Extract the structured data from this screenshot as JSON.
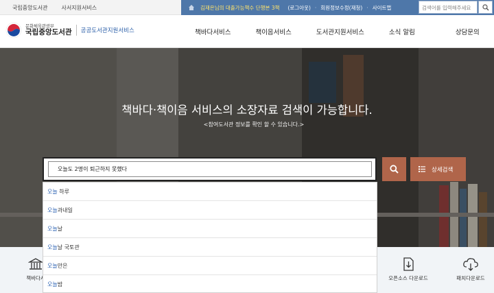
{
  "util_bar": {
    "links_left": [
      "국립중앙도서관",
      "사서지원서비스"
    ],
    "user_text": "김재은님의 대출가능책수 단행본 3책",
    "links_right": [
      "(로그아웃)",
      "회원정보수정(재청)",
      "사이트맵"
    ],
    "search_placeholder": "검색어를 입력해주세요",
    "bar_color": "#4e77a9"
  },
  "logo": {
    "ministry": "문화체육관광부",
    "name": "국립중앙도서관",
    "service": "공공도서관지원서비스"
  },
  "nav": [
    "책바다서비스",
    "책이음서비스",
    "도서관지원서비스",
    "소식 알림",
    "상담문의"
  ],
  "hero": {
    "title": "책바다·책이음 서비스의 소장자료 검색이 가능합니다.",
    "subtitle": "<참여도서관 정보를 확인 할 수 있습니다.>",
    "search_value": "오늘도 2명이 퇴근하지 못했다",
    "advanced_label": "상세검색",
    "accent_color": "#b0654a"
  },
  "suggestions": [
    {
      "highlight": "오늘",
      "rest": " 하루"
    },
    {
      "highlight": "오늘",
      "rest": "과내일"
    },
    {
      "highlight": "오늘",
      "rest": "날"
    },
    {
      "highlight": "오늘",
      "rest": "날 국토관"
    },
    {
      "highlight": "오늘",
      "rest": "만은"
    },
    {
      "highlight": "오늘",
      "rest": "밤"
    }
  ],
  "quick_links": [
    {
      "label": "책바다서",
      "icon": "library-building-icon"
    },
    {
      "label": "오픈소스 다운로드",
      "icon": "download-doc-icon"
    },
    {
      "label": "패치다운로드",
      "icon": "cloud-download-icon"
    }
  ]
}
